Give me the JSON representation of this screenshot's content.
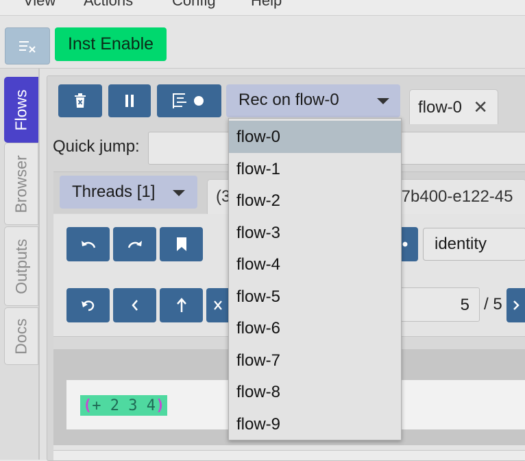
{
  "menubar": {
    "items": [
      "View",
      "Actions",
      "Config",
      "Help"
    ]
  },
  "toolbar": {
    "clear_icon": "clear-list-icon",
    "inst_enable_label": "Inst Enable"
  },
  "sidebar": {
    "tabs": [
      "Flows",
      "Browser",
      "Outputs",
      "Docs"
    ],
    "active": "Flows"
  },
  "flows": {
    "rec_select_label": "Rec on flow-0",
    "flow_tab_label": "flow-0",
    "flow_tab_close": "✕",
    "quick_jump_label": "Quick jump:",
    "quick_jump_value": "",
    "dropdown_options": [
      "flow-0",
      "flow-1",
      "flow-2",
      "flow-3",
      "flow-4",
      "flow-5",
      "flow-6",
      "flow-7",
      "flow-8",
      "flow-9"
    ],
    "selected_option": "flow-0"
  },
  "threads": {
    "select_label": "Threads [1]",
    "thread_tab_left": "(3",
    "thread_tab_right": "f7b400-e122-45"
  },
  "controls": {
    "identity_value": "identity",
    "step_value": "5",
    "step_total": "/ 5"
  },
  "expression": {
    "open": "(",
    "body": "+ 2 3 4",
    "close": ")"
  },
  "colors": {
    "button_blue": "#3a6795",
    "inst_green": "#00d86e",
    "active_tab": "#4b42c9",
    "select_bg": "#bcc3dc",
    "expr_bg": "#4fd9a0",
    "paren": "#c64ad2"
  }
}
